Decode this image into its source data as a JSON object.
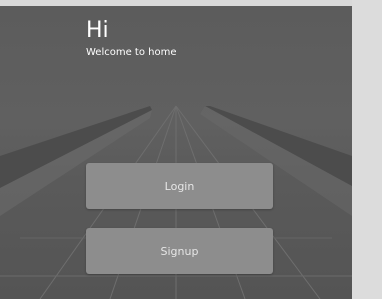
{
  "header": {
    "greeting": "Hi",
    "subtitle": "Welcome to home"
  },
  "actions": {
    "login_label": "Login",
    "signup_label": "Signup"
  },
  "colors": {
    "background": "#5c5c5c",
    "button": "#8d8d8d",
    "button_text": "#e6e6e6",
    "heading_text": "#ffffff"
  }
}
